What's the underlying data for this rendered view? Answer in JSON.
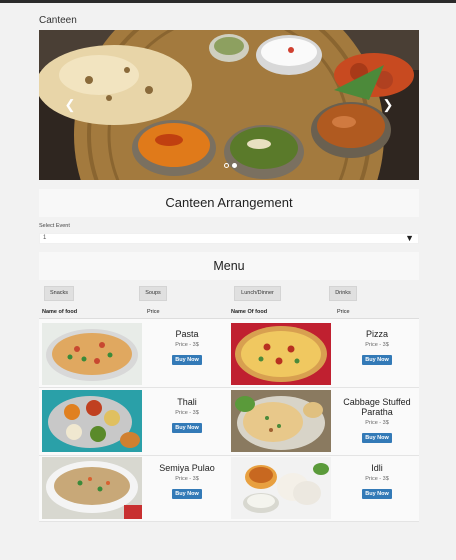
{
  "app": {
    "title": "Canteen"
  },
  "sections": {
    "arrangement_title": "Canteen Arrangement",
    "menu_title": "Menu"
  },
  "event": {
    "label": "Select Event",
    "value": "1"
  },
  "categories": [
    "Snacks",
    "Soups",
    "Lunch/Dinner",
    "Drinks"
  ],
  "columns": {
    "name_left": "Name of food",
    "price_left": "Price",
    "name_right": "Name Of food",
    "price_right": "Price"
  },
  "foods": [
    {
      "name": "Pasta",
      "price": "Price - 3$",
      "button": "Buy Now",
      "image": "pasta-photo"
    },
    {
      "name": "Pizza",
      "price": "Price - 3$",
      "button": "Buy Now",
      "image": "pizza-photo"
    },
    {
      "name": "Thali",
      "price": "Price - 3$",
      "button": "Buy Now",
      "image": "thali-photo"
    },
    {
      "name": "Cabbage Stuffed Paratha",
      "price": "Price - 3$",
      "button": "Buy Now",
      "image": "paratha-photo"
    },
    {
      "name": "Semiya Pulao",
      "price": "Price - 3$",
      "button": "Buy Now",
      "image": "pulao-photo"
    },
    {
      "name": "Idli",
      "price": "Price - 3$",
      "button": "Buy Now",
      "image": "idli-photo"
    }
  ],
  "carousel": {
    "slide_count": 2,
    "active_slide": 1,
    "image": "naan-curry-photo"
  },
  "colors": {
    "buy_button": "#337ab7",
    "page_background": "#f2f2f2",
    "top_bar": "#2b2b2b"
  }
}
